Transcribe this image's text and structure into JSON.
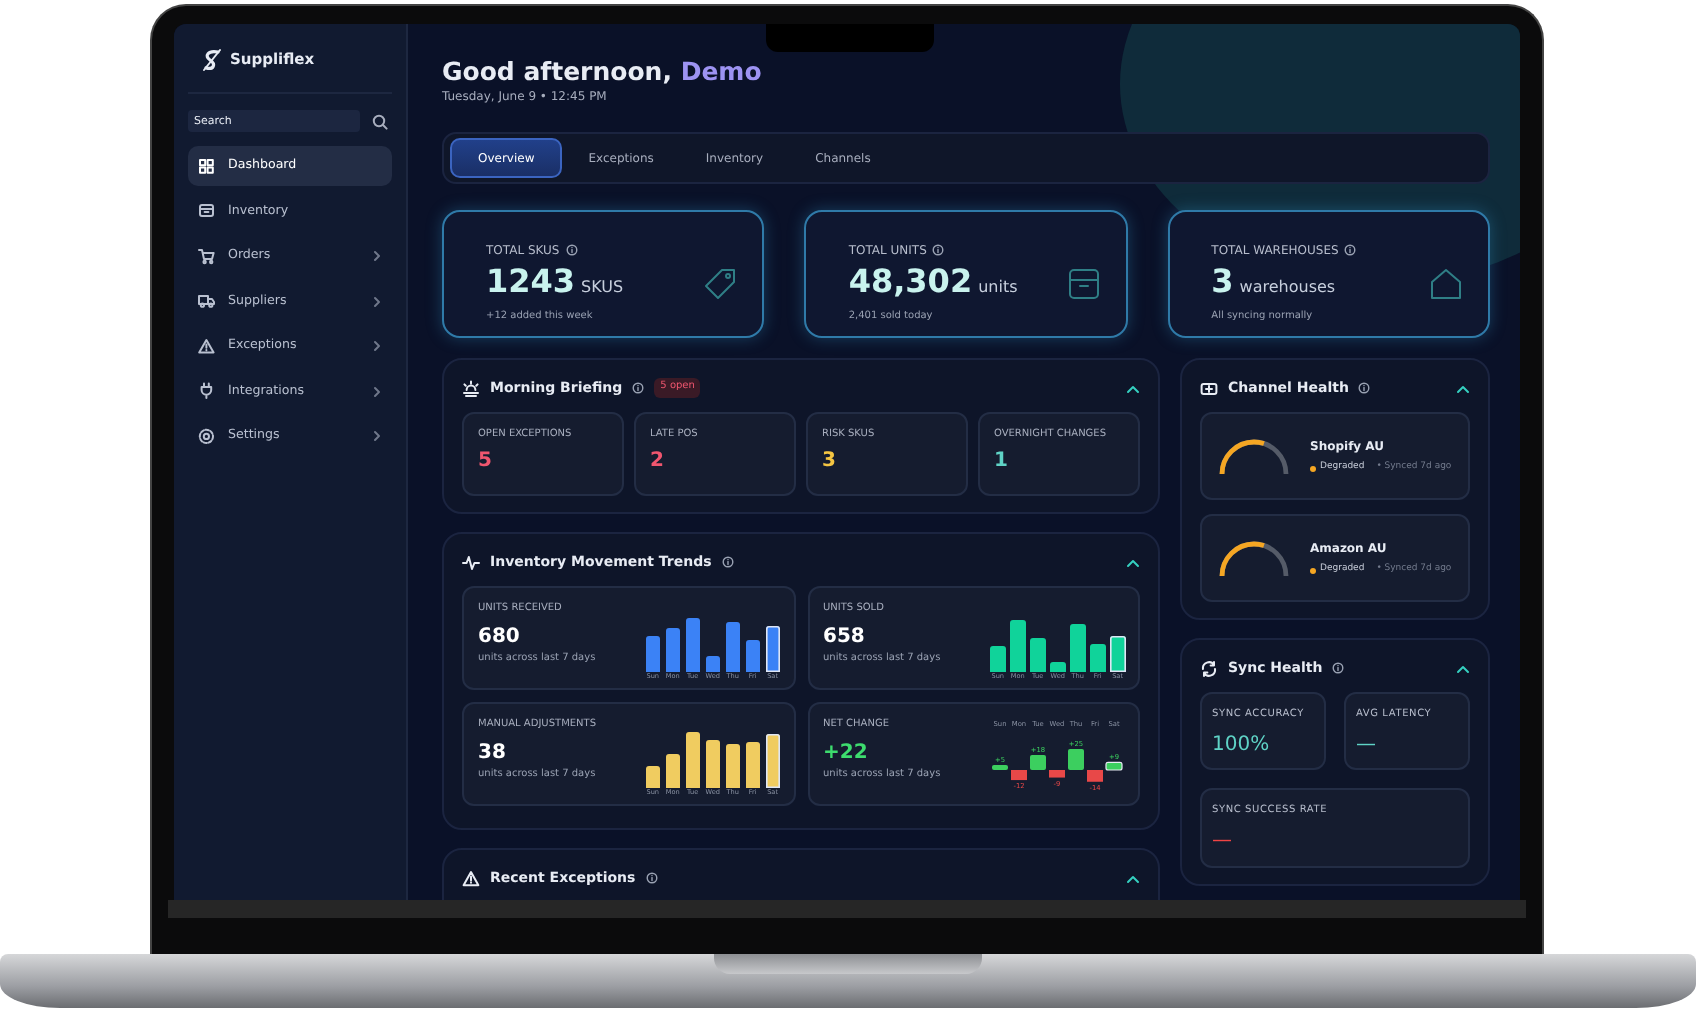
{
  "sidebar": {
    "brand": "Suppliflex",
    "search": {
      "placeholder": "Search"
    },
    "items": [
      {
        "label": "Dashboard",
        "selected": true,
        "expandable": false
      },
      {
        "label": "Inventory",
        "selected": false,
        "expandable": false
      },
      {
        "label": "Orders",
        "selected": false,
        "expandable": true
      },
      {
        "label": "Suppliers",
        "selected": false,
        "expandable": true
      },
      {
        "label": "Exceptions",
        "selected": false,
        "expandable": true
      },
      {
        "label": "Integrations",
        "selected": false,
        "expandable": true
      },
      {
        "label": "Settings",
        "selected": false,
        "expandable": true
      }
    ]
  },
  "header": {
    "greeting": "Good afternoon,",
    "name": "Demo",
    "date": "Tuesday, June 9 • 12:45 PM"
  },
  "tabs": [
    {
      "label": "Overview",
      "selected": true
    },
    {
      "label": "Exceptions",
      "selected": false
    },
    {
      "label": "Inventory",
      "selected": false
    },
    {
      "label": "Channels",
      "selected": false
    }
  ],
  "stats": [
    {
      "label": "TOTAL SKUS",
      "value": "1243",
      "unit": "SKUS",
      "note": "+12 added this week"
    },
    {
      "label": "TOTAL UNITS",
      "value": "48,302",
      "unit": "units",
      "note": "2,401 sold today"
    },
    {
      "label": "TOTAL WAREHOUSES",
      "value": "3",
      "unit": "warehouses",
      "note": "All syncing normally"
    }
  ],
  "briefing": {
    "title": "Morning Briefing",
    "badge": "5 open",
    "expanded": true,
    "tiles": [
      {
        "label": "OPEN EXCEPTIONS",
        "value": "5",
        "color": "#f0566f"
      },
      {
        "label": "LATE POS",
        "value": "2",
        "color": "#f0566f"
      },
      {
        "label": "RISK SKUS",
        "value": "3",
        "color": "#f5c542"
      },
      {
        "label": "OVERNIGHT CHANGES",
        "value": "1",
        "color": "#5fd3c6"
      }
    ]
  },
  "trends": {
    "title": "Inventory Movement Trends",
    "expanded": true,
    "tiles": [
      {
        "kind": "bars",
        "label": "UNITS RECEIVED",
        "value": "680",
        "note": "units across last 7 days",
        "color": "#3b82f6",
        "days": [
          "Sun",
          "Mon",
          "Tue",
          "Wed",
          "Thu",
          "Fri",
          "Sat"
        ]
      },
      {
        "kind": "bars",
        "label": "UNITS SOLD",
        "value": "658",
        "note": "units across last 7 days",
        "color": "#10d39a",
        "days": [
          "Sun",
          "Mon",
          "Tue",
          "Wed",
          "Thu",
          "Fri",
          "Sat"
        ]
      },
      {
        "kind": "bars",
        "label": "MANUAL ADJUSTMENTS",
        "value": "38",
        "note": "units across last 7 days",
        "color": "#f0cc60",
        "days": [
          "Sun",
          "Mon",
          "Tue",
          "Wed",
          "Thu",
          "Fri",
          "Sat"
        ]
      },
      {
        "kind": "net",
        "label": "NET CHANGE",
        "value": "+22",
        "note": "units across last 7 days",
        "chart_data": {
          "type": "bar",
          "categories": [
            "Sun",
            "Mon",
            "Tue",
            "Wed",
            "Thu",
            "Fri",
            "Sat"
          ],
          "values": [
            5,
            -12,
            18,
            -9,
            25,
            -14,
            9
          ],
          "value_labels": [
            "+5",
            "-12",
            "+18",
            "-9",
            "+25",
            "-14",
            "+9"
          ]
        }
      }
    ]
  },
  "recent_exceptions": {
    "title": "Recent Exceptions",
    "expanded": true
  },
  "channel_health": {
    "title": "Channel Health",
    "expanded": true,
    "channels": [
      {
        "name": "Shopify AU",
        "status": "Degraded",
        "color": "#f5a623",
        "synced": "• Synced 7d ago"
      },
      {
        "name": "Amazon AU",
        "status": "Degraded",
        "color": "#f5a623",
        "synced": "• Synced 7d ago"
      }
    ]
  },
  "sync_health": {
    "title": "Sync Health",
    "expanded": true,
    "tiles": [
      {
        "label": "SYNC ACCURACY",
        "value": "100%",
        "color": "#5fd3c6"
      },
      {
        "label": "AVG LATENCY",
        "value": "—",
        "color": "#5fd3c6"
      },
      {
        "label": "SYNC SUCCESS RATE",
        "value": "—",
        "color": "#f04444"
      }
    ]
  }
}
